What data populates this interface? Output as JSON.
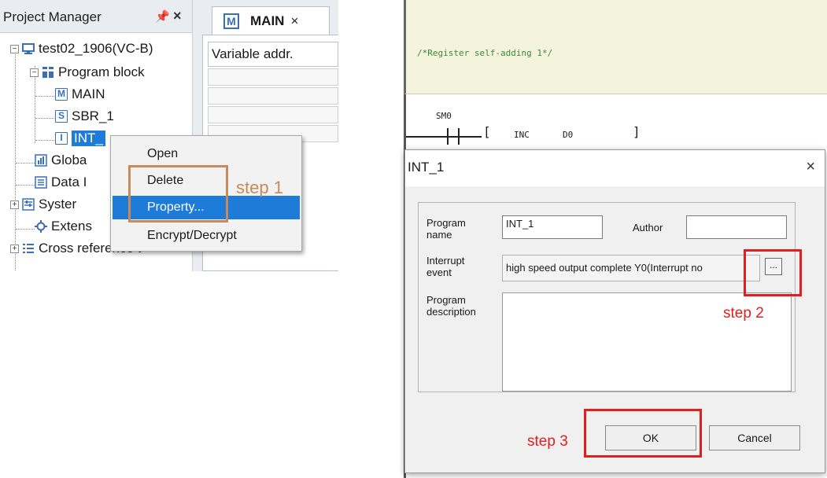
{
  "project_manager": {
    "title": "Project Manager",
    "pin_glyph": "#",
    "close_glyph": "×",
    "tree": [
      {
        "label": "test02_1906(VC-B)",
        "icon": "plc-icon",
        "expander": "−"
      },
      {
        "label": "Program block",
        "icon": "program-block-icon",
        "expander": "−"
      },
      {
        "label": "MAIN",
        "icon": "main-icon",
        "icon_letter": "M"
      },
      {
        "label": "SBR_1",
        "icon": "subroutine-icon",
        "icon_letter": "S"
      },
      {
        "label": "INT_",
        "icon": "interrupt-icon",
        "icon_letter": "I"
      },
      {
        "label": "Globa",
        "icon": "global-var-icon"
      },
      {
        "label": "Data I",
        "icon": "data-icon"
      },
      {
        "label": "Syster",
        "icon": "system-icon",
        "expander": "+"
      },
      {
        "label": "Extens",
        "icon": "extension-icon"
      },
      {
        "label": "Cross reference t",
        "icon": "cross-reference-icon",
        "expander": "+"
      }
    ]
  },
  "editor_tab": {
    "label": "MAIN",
    "icon_letter": "M",
    "close_glyph": "×"
  },
  "variable_table": {
    "header": "Variable addr."
  },
  "context_menu": {
    "items": [
      "Open",
      "Delete",
      "Property...",
      "Encrypt/Decrypt"
    ],
    "highlighted": "Property..."
  },
  "annotations": {
    "step1": "step 1",
    "step2": "step 2",
    "step3": "step 3",
    "highlight_color": "#e02020",
    "step1_color": "#c8895a"
  },
  "ladder": {
    "comment": "/*Register self-adding 1*/",
    "contact": "SM0",
    "instruction": "INC",
    "operand": "D0",
    "bracket_open": "[",
    "bracket_close": "]"
  },
  "dialog": {
    "title": "INT_1",
    "close_glyph": "×",
    "program_name_label": "Program name",
    "program_name_value": "INT_1",
    "author_label": "Author",
    "author_value": "",
    "interrupt_event_label": "Interrupt event",
    "interrupt_event_value": "high speed output complete Y0(Interrupt no",
    "browse_label": "...",
    "description_label": "Program description",
    "description_value": "",
    "ok_label": "OK",
    "cancel_label": "Cancel"
  },
  "colors": {
    "menu_highlight": "#1f7bd8",
    "icon_blue": "#3a6fb8",
    "comment_bg": "#f4f4dc"
  }
}
